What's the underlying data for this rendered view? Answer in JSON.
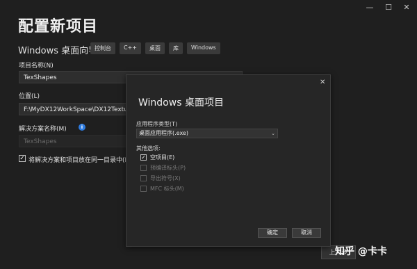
{
  "window_controls": {
    "close": "✕",
    "maximize": "☐",
    "minimize": "—"
  },
  "page": {
    "title": "配置新项目",
    "subtitle": "Windows 桌面向导",
    "tags": [
      "控制台",
      "C++",
      "桌面",
      "库",
      "Windows"
    ]
  },
  "form": {
    "project_name_label": "项目名称(N)",
    "project_name_value": "TexShapes",
    "location_label": "位置(L)",
    "location_value": "F:\\MyDX12WorkSpace\\DX12Texture\\",
    "solution_name_label": "解决方案名称(M)",
    "solution_name_value": "TexShapes",
    "same_dir_label": "将解决方案和项目放在同一目录中(D)",
    "same_dir_checked": true,
    "back_button": "上一步"
  },
  "dialog": {
    "title": "Windows 桌面项目",
    "close": "✕",
    "app_type_label": "应用程序类型(T)",
    "app_type_value": "桌面应用程序(.exe)",
    "other_options_label": "其他选项:",
    "options": [
      {
        "label": "空项目(E)",
        "checked": true,
        "enabled": true
      },
      {
        "label": "预编译标头(P)",
        "checked": false,
        "enabled": false
      },
      {
        "label": "导出符号(X)",
        "checked": false,
        "enabled": false
      },
      {
        "label": "MFC 标头(M)",
        "checked": false,
        "enabled": false
      }
    ],
    "ok_button": "确定",
    "cancel_button": "取消"
  },
  "watermark": "知乎 @卡卡",
  "colors": {
    "background": "#1f1f1f",
    "dialog": "#262626",
    "info": "#2d7be0"
  }
}
